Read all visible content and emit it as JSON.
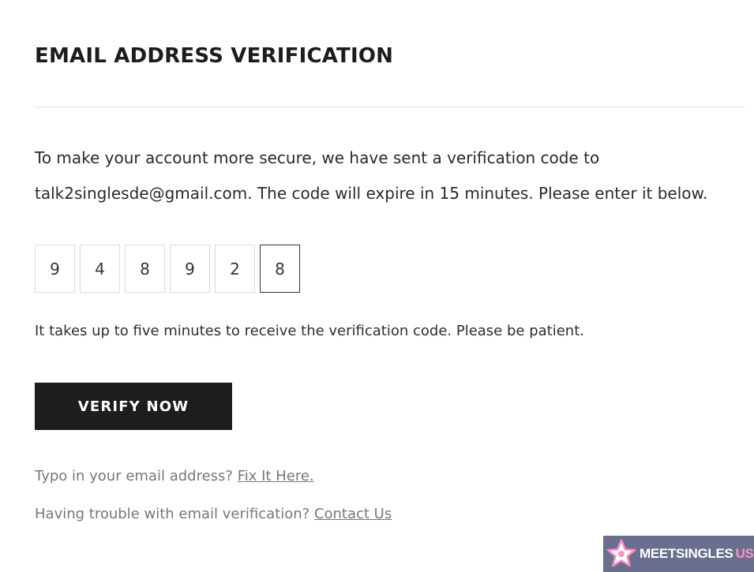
{
  "header": {
    "title": "EMAIL ADDRESS VERIFICATION"
  },
  "intro": {
    "line1": "To make your account more secure, we have sent a verification code to",
    "line2": "talk2singlesde@gmail.com. The code will expire in 15 minutes. Please enter it below."
  },
  "code": {
    "digits": [
      "9",
      "4",
      "8",
      "9",
      "2",
      "8"
    ],
    "focused_index": 5
  },
  "hint": "It takes up to five minutes to receive the verification code. Please be patient.",
  "verify_button": {
    "label": "VERIFY NOW"
  },
  "help": {
    "typo_text": "Typo in your email address?",
    "typo_link": "Fix It Here.",
    "trouble_text": "Having trouble with email verification?",
    "trouble_link": "Contact Us"
  },
  "watermark": {
    "brand": "MEETSINGLES",
    "suffix": "USA",
    "icon": "star-icon",
    "background": "#6a6f8f",
    "accent": "#ff8fc7"
  },
  "colors": {
    "button_bg": "#1d1d1d",
    "text": "#222222",
    "muted": "#777777",
    "border": "#dcdcdc"
  }
}
